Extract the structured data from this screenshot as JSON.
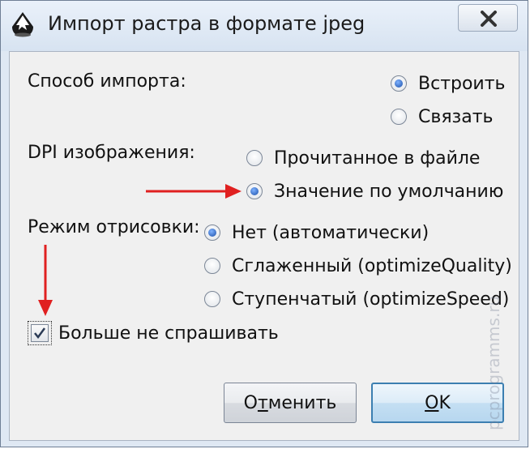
{
  "window": {
    "title": "Импорт растра в формате jpeg",
    "icon": "inkscape-icon",
    "close_icon": "close-icon"
  },
  "import_mode": {
    "label": "Способ импорта:",
    "options": [
      "Встроить",
      "Связать"
    ],
    "selected": "Встроить"
  },
  "dpi": {
    "label": "DPI изображения:",
    "options": [
      "Прочитанное в файле",
      "Значение по умолчанию"
    ],
    "selected": "Значение по умолчанию"
  },
  "render_mode": {
    "label": "Режим отрисовки:",
    "options": [
      "Нет (автоматически)",
      "Сглаженный (optimizeQuality)",
      "Ступенчатый (optimizeSpeed)"
    ],
    "selected": "Нет (автоматически)"
  },
  "dont_ask": {
    "label": "Больше не спрашивать",
    "checked": true
  },
  "buttons": {
    "cancel_prefix": "О",
    "cancel_mnemonic": "т",
    "cancel_suffix": "менить",
    "ok_mnemonic": "O",
    "ok_suffix": "K"
  },
  "watermark": "pcprogramms.ru",
  "colors": {
    "annotation_arrow": "#e02020",
    "accent": "#1b4fa8"
  }
}
